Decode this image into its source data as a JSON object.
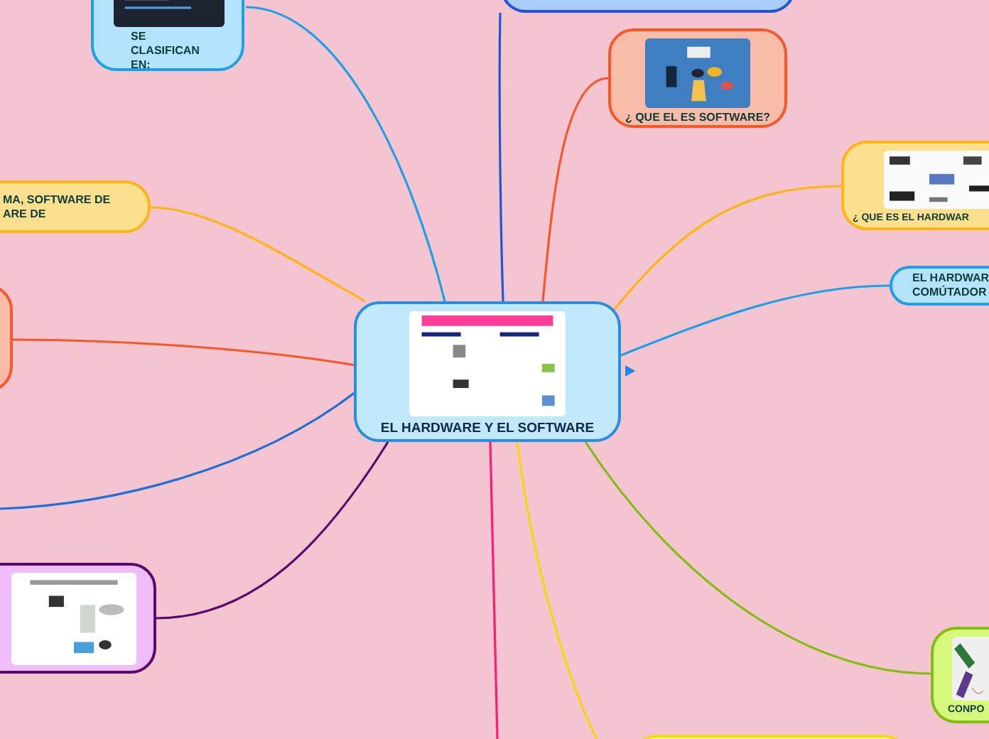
{
  "central": {
    "title": "EL HARDWARE Y EL SOFTWARE"
  },
  "branches": [
    {
      "kind": "picture-node",
      "color": "#1ea0e6",
      "lines": [
        "SE CLASIFICAN EN:"
      ]
    },
    {
      "kind": "node",
      "color": "#1f56d1"
    },
    {
      "kind": "picture-node",
      "color": "#f6582a",
      "lines": [
        "¿ QUE EL ES SOFTWARE?"
      ]
    },
    {
      "kind": "picture-node",
      "color": "#fdb515",
      "lines": [
        "¿ QUE ES EL HARDWAR"
      ]
    },
    {
      "kind": "node",
      "color": "#1ea0e6",
      "lines": [
        "EL HARDWAR",
        "COMÚTADOR"
      ]
    },
    {
      "kind": "node",
      "color": "#fdb515",
      "lines": [
        "MA, SOFTWARE DE",
        "ARE DE"
      ]
    },
    {
      "kind": "node",
      "color": "#f6582a"
    },
    {
      "kind": "edge",
      "color": "#1f6fd6"
    },
    {
      "kind": "picture-node",
      "color": "#5a0a6b"
    },
    {
      "kind": "picture-node",
      "color": "#84bd12",
      "lines": [
        "CONPO"
      ]
    },
    {
      "kind": "node",
      "color": "#f2d80c"
    },
    {
      "kind": "edge",
      "color": "#ff1a75"
    }
  ]
}
